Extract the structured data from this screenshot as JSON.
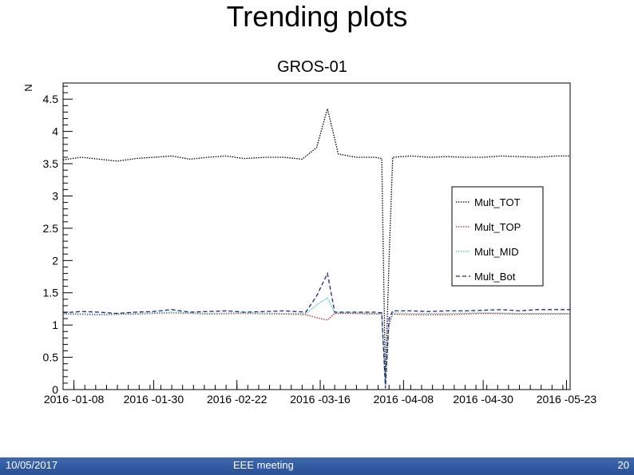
{
  "slide": {
    "title": "Trending plots"
  },
  "footer": {
    "date": "10/05/2017",
    "center": "EEE meeting",
    "page": "20"
  },
  "chart_data": {
    "type": "line",
    "title": "GROS-01",
    "ylabel": "N",
    "xlabel": "",
    "ylim": [
      0,
      4.75
    ],
    "yticks": [
      0,
      0.5,
      1,
      1.5,
      2,
      2.5,
      3,
      3.5,
      4,
      4.5
    ],
    "ytick_labels": [
      "0",
      "0.5",
      "1",
      "1.5",
      "2",
      "2.5",
      "3",
      "3.5",
      "4",
      "4.5"
    ],
    "xlim": [
      "2016-01-05",
      "2016-05-24"
    ],
    "xtick_labels": [
      "2016 -01-08",
      "2016 -01-30",
      "2016 -02-22",
      "2016 -03-16",
      "2016 -04-08",
      "2016 -04-30",
      "2016 -05-23"
    ],
    "xtick_dates": [
      "2016-01-08",
      "2016-01-30",
      "2016-02-22",
      "2016-03-16",
      "2016-04-08",
      "2016-04-30",
      "2016-05-23"
    ],
    "grid": false,
    "legend": "right",
    "series": [
      {
        "name": "Mult_TOT",
        "color": "#000000",
        "dash": "dot",
        "x": [
          "2016-01-05",
          "2016-01-10",
          "2016-01-15",
          "2016-01-20",
          "2016-01-25",
          "2016-01-30",
          "2016-02-04",
          "2016-02-09",
          "2016-02-14",
          "2016-02-19",
          "2016-02-24",
          "2016-03-01",
          "2016-03-06",
          "2016-03-11",
          "2016-03-15",
          "2016-03-18",
          "2016-03-21",
          "2016-03-26",
          "2016-03-31",
          "2016-04-02",
          "2016-04-03",
          "2016-04-04",
          "2016-04-05",
          "2016-04-10",
          "2016-04-15",
          "2016-04-20",
          "2016-04-25",
          "2016-04-30",
          "2016-05-05",
          "2016-05-10",
          "2016-05-15",
          "2016-05-20",
          "2016-05-24"
        ],
        "y": [
          3.56,
          3.6,
          3.57,
          3.54,
          3.58,
          3.6,
          3.62,
          3.57,
          3.6,
          3.62,
          3.58,
          3.6,
          3.6,
          3.57,
          3.75,
          4.35,
          3.65,
          3.6,
          3.6,
          3.58,
          0.1,
          2.0,
          3.6,
          3.62,
          3.6,
          3.61,
          3.6,
          3.6,
          3.62,
          3.61,
          3.6,
          3.62,
          3.62
        ]
      },
      {
        "name": "Mult_TOP",
        "color": "#d42020",
        "dash": "dot",
        "x": [
          "2016-01-05",
          "2016-01-15",
          "2016-01-25",
          "2016-02-04",
          "2016-02-14",
          "2016-02-24",
          "2016-03-06",
          "2016-03-12",
          "2016-03-16",
          "2016-03-18",
          "2016-03-20",
          "2016-03-25",
          "2016-03-31",
          "2016-04-02",
          "2016-04-03",
          "2016-04-04",
          "2016-04-05",
          "2016-04-10",
          "2016-04-20",
          "2016-04-30",
          "2016-05-10",
          "2016-05-24"
        ],
        "y": [
          1.17,
          1.16,
          1.17,
          1.19,
          1.17,
          1.18,
          1.17,
          1.16,
          1.1,
          1.08,
          1.18,
          1.18,
          1.17,
          1.17,
          0.08,
          1.0,
          1.17,
          1.16,
          1.16,
          1.18,
          1.17,
          1.17
        ]
      },
      {
        "name": "Mult_MID",
        "color": "#3cc4b4",
        "dash": "dot",
        "x": [
          "2016-01-05",
          "2016-01-15",
          "2016-01-25",
          "2016-02-04",
          "2016-02-14",
          "2016-02-24",
          "2016-03-06",
          "2016-03-12",
          "2016-03-16",
          "2016-03-18",
          "2016-03-20",
          "2016-03-25",
          "2016-03-31",
          "2016-04-02",
          "2016-04-03",
          "2016-04-04",
          "2016-04-05",
          "2016-04-10",
          "2016-04-20",
          "2016-04-30",
          "2016-05-10",
          "2016-05-24"
        ],
        "y": [
          1.18,
          1.17,
          1.18,
          1.2,
          1.18,
          1.19,
          1.18,
          1.18,
          1.35,
          1.42,
          1.19,
          1.19,
          1.18,
          1.18,
          0.06,
          1.05,
          1.19,
          1.18,
          1.18,
          1.19,
          1.18,
          1.18
        ]
      },
      {
        "name": "Mult_Bot",
        "color": "#1a2b8c",
        "dash": "dash",
        "x": [
          "2016-01-05",
          "2016-01-10",
          "2016-01-15",
          "2016-01-20",
          "2016-01-25",
          "2016-01-30",
          "2016-02-04",
          "2016-02-09",
          "2016-02-14",
          "2016-02-19",
          "2016-02-24",
          "2016-03-01",
          "2016-03-06",
          "2016-03-12",
          "2016-03-15",
          "2016-03-18",
          "2016-03-20",
          "2016-03-25",
          "2016-03-31",
          "2016-04-02",
          "2016-04-03",
          "2016-04-04",
          "2016-04-05",
          "2016-04-10",
          "2016-04-15",
          "2016-04-20",
          "2016-04-25",
          "2016-04-30",
          "2016-05-05",
          "2016-05-10",
          "2016-05-15",
          "2016-05-20",
          "2016-05-24"
        ],
        "y": [
          1.19,
          1.21,
          1.2,
          1.18,
          1.2,
          1.21,
          1.24,
          1.2,
          1.21,
          1.22,
          1.2,
          1.21,
          1.22,
          1.2,
          1.45,
          1.8,
          1.2,
          1.2,
          1.2,
          1.19,
          0.02,
          1.1,
          1.22,
          1.22,
          1.21,
          1.22,
          1.22,
          1.23,
          1.24,
          1.22,
          1.24,
          1.24,
          1.24
        ]
      }
    ]
  }
}
